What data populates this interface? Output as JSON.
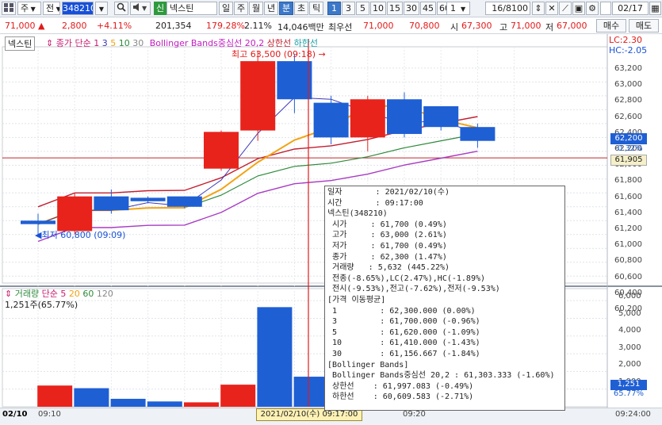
{
  "toolbar": {
    "icon_grid": "grid-icon",
    "mode": "주",
    "type": "전",
    "code": "348210",
    "search_icon": "search-icon",
    "sound_icon": "speaker-icon",
    "credit_badge": "신",
    "stock_name": "넥스틴",
    "periods": [
      "일",
      "주",
      "월",
      "년",
      "분",
      "초",
      "틱"
    ],
    "period_selected": "분",
    "minutes": [
      "1",
      "3",
      "5",
      "10",
      "15",
      "30",
      "45",
      "60"
    ],
    "minute_selected": "1",
    "count": "1",
    "page_info": "16/8100",
    "date": "02/17"
  },
  "info": {
    "price": "71,000",
    "change_arrow": "▲",
    "change": "2,800",
    "change_pct": "+4.11%",
    "volume": "201,354",
    "volume_pct": "179.28%",
    "turnover": "2.11%",
    "amount": "14,046백만",
    "best_ask_label": "최우선",
    "best_ask": "71,000",
    "best_bid": "70,800",
    "open_label": "시",
    "open": "67,300",
    "high_label": "고",
    "high": "71,000",
    "low_label": "저",
    "low": "67,000",
    "buy": "매수",
    "sell": "매도"
  },
  "legend": {
    "stock": "넥스틴",
    "ma_label": "종가 단순",
    "ma_periods": [
      "1",
      "3",
      "5",
      "10",
      "30"
    ],
    "bb_label": "Bollinger Bands중심선 20,2",
    "upper": "상한선",
    "lower": "하한선",
    "lc": "LC:2.30",
    "hc": "HC:-2.05",
    "vol_label": "거래량",
    "vol_ma_label": "단순",
    "vol_ma_periods": [
      "5",
      "20",
      "60",
      "120"
    ],
    "vol_value": "1,251주(65.77%)"
  },
  "annotations": {
    "high": "최고 63,500 (09:18)",
    "low": "최저 60,800 (09:09)"
  },
  "price_axis": [
    "63,200",
    "63,000",
    "62,800",
    "62,600",
    "62,400",
    "62,200",
    "62,000",
    "61,800",
    "61,600",
    "61,400",
    "61,200",
    "61,000",
    "60,800",
    "60,600",
    "60,400",
    "60,200"
  ],
  "price_tags": {
    "current": "62,200",
    "current_pct": "-0.32%",
    "ref": "61,905"
  },
  "volume_axis": [
    "6,000",
    "5,000",
    "4,000",
    "3,000",
    "2,000",
    "1,000"
  ],
  "volume_tags": {
    "current": "1,251",
    "current_pct": "65.77%"
  },
  "time_axis": {
    "date": "02/10",
    "t1": "09:10",
    "t2": "09:20",
    "end": "09:24:00",
    "cursor": "2021/02/10(수) 09:17:00"
  },
  "tooltip": [
    "일자       : 2021/02/10(수)",
    "시간       : 09:17:00",
    "넥스틴(348210)",
    " 시가     : 61,700 (0.49%)",
    " 고가     : 63,000 (2.61%)",
    " 저가     : 61,700 (0.49%)",
    " 종가     : 62,300 (1.47%)",
    " 거래량   : 5,632 (445.22%)",
    " 전종(-8.65%),LC(2.47%),HC(-1.89%)",
    " 전시(-9.53%),전고(-7.62%),전저(-9.53%)",
    "[가격 이동평균]",
    " 1         : 62,300.000 (0.00%)",
    " 3         : 61,700.000 (-0.96%)",
    " 5         : 61,620.000 (-1.09%)",
    " 10        : 61,410.000 (-1.43%)",
    " 30        : 61,156.667 (-1.84%)",
    "[Bollinger Bands]",
    " Bollinger Bands중심선 20,2 : 61,303.333 (-1.60%)",
    " 상한선    : 61,997.083 (-0.49%)",
    " 하한선    : 60,609.583 (-2.71%)"
  ],
  "chart_data": {
    "type": "candlestick",
    "price_min": 60100,
    "price_max": 63450,
    "candles": [
      {
        "time": "09:08",
        "open": 61000,
        "high": 61100,
        "low": 60800,
        "close": 60950
      },
      {
        "time": "09:09",
        "open": 60850,
        "high": 61400,
        "low": 60800,
        "close": 61350
      },
      {
        "time": "09:10",
        "open": 61350,
        "high": 61450,
        "low": 61100,
        "close": 61150
      },
      {
        "time": "09:11",
        "open": 61330,
        "high": 61350,
        "low": 61250,
        "close": 61280
      },
      {
        "time": "09:13",
        "open": 61350,
        "high": 61350,
        "low": 61180,
        "close": 61200
      },
      {
        "time": "09:16",
        "open": 61750,
        "high": 62300,
        "low": 61720,
        "close": 62280
      },
      {
        "time": "09:17",
        "open": 62300,
        "high": 63450,
        "low": 62150,
        "close": 63300
      },
      {
        "time": "09:18",
        "open": 63300,
        "high": 63400,
        "low": 62550,
        "close": 62750
      },
      {
        "time": "09:19",
        "open": 62700,
        "high": 62800,
        "low": 62100,
        "close": 62200
      },
      {
        "time": "09:20",
        "open": 62200,
        "high": 62800,
        "low": 62000,
        "close": 62750
      },
      {
        "time": "09:21",
        "open": 62750,
        "high": 62850,
        "low": 62200,
        "close": 62250
      },
      {
        "time": "09:22",
        "open": 62650,
        "high": 62650,
        "low": 62300,
        "close": 62350
      },
      {
        "time": "09:23",
        "open": 62350,
        "high": 62400,
        "low": 62050,
        "close": 62150
      }
    ],
    "volume_max": 6500,
    "volumes": [
      0,
      1200,
      1050,
      450,
      300,
      250,
      1250,
      5632,
      1700,
      1300,
      900,
      700,
      600,
      1251
    ]
  },
  "colors": {
    "up": "#e8231c",
    "down": "#1f5fd4",
    "accent": "#3b78c9",
    "ma5": "#f2a313",
    "ma3": "#3a37b8",
    "bb_mid": "#2d8a3a",
    "bb_up": "#c21e2f",
    "bb_low": "#a83cc4"
  }
}
